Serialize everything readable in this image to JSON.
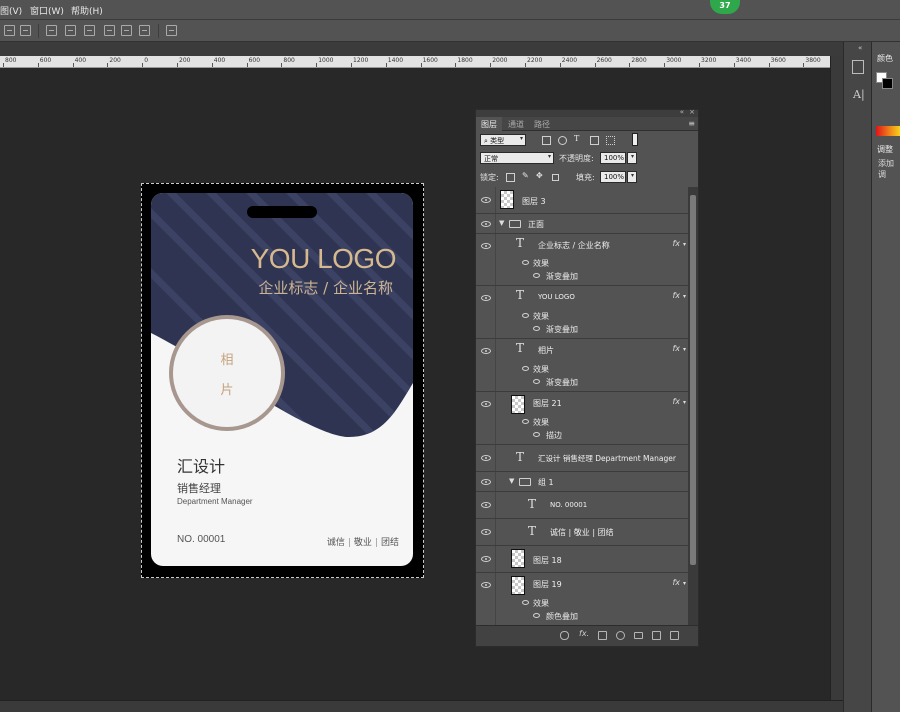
{
  "menu": {
    "items": [
      "图(V)",
      "窗口(W)",
      "帮助(H)"
    ]
  },
  "badge_count": "37",
  "ruler": {
    "labels": [
      "800",
      "600",
      "400",
      "200",
      "0",
      "200",
      "400",
      "600",
      "800",
      "1000",
      "1200",
      "1400",
      "1600",
      "1800",
      "2000",
      "2200",
      "2400",
      "2600",
      "2800",
      "3000",
      "3200",
      "3400",
      "3600",
      "3800"
    ]
  },
  "card": {
    "logo": "YOU LOGO",
    "logo_sub": "企业标志 / 企业名称",
    "photo_line1": "相",
    "photo_line2": "片",
    "name": "汇设计",
    "title": "销售经理",
    "dept": "Department Manager",
    "number": "NO. 00001",
    "values": [
      "诚信",
      "敬业",
      "团结"
    ],
    "colors": {
      "navy": "#2e3452",
      "gold": "#d7b98f",
      "stripe": "#3c4264"
    }
  },
  "layers_panel": {
    "tabs": [
      "图层",
      "通道",
      "路径"
    ],
    "filter": {
      "label": "类型"
    },
    "blend_mode": "正常",
    "opacity": {
      "label": "不透明度:",
      "value": "100%"
    },
    "lock": {
      "label": "锁定:"
    },
    "fill": {
      "label": "填充:",
      "value": "100%"
    },
    "layers": [
      {
        "name": "图层 3"
      },
      {
        "name": "正面"
      },
      {
        "name": "企业标志 / 企业名称",
        "fx": "fx",
        "effect_label": "效果",
        "effect": "渐变叠加"
      },
      {
        "name": "YOU LOGO",
        "fx": "fx",
        "effect_label": "效果",
        "effect": "渐变叠加"
      },
      {
        "name": "相片",
        "fx": "fx",
        "effect_label": "效果",
        "effect": "渐变叠加"
      },
      {
        "name": "图层 21",
        "fx": "fx",
        "effect_label": "效果",
        "effect": "描边"
      },
      {
        "name": "汇设计 销售经理 Department Manager"
      },
      {
        "name": "组 1"
      },
      {
        "name": "NO. 00001"
      },
      {
        "name": "诚信 | 敬业 | 团结"
      },
      {
        "name": "图层 18"
      },
      {
        "name": "图层 19",
        "fx": "fx",
        "effect_label": "效果",
        "effect": "颜色叠加"
      }
    ]
  },
  "dock": {
    "color_tab": "颜色",
    "adjust_tab": "调整",
    "adjust_add": "添加调"
  }
}
